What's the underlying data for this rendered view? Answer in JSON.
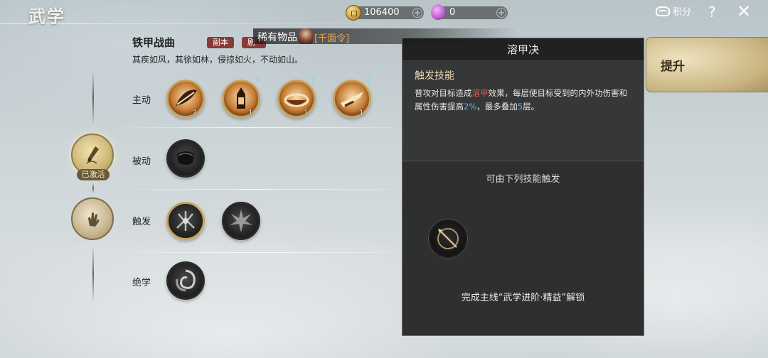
{
  "header": {
    "title": "武学",
    "coins": "106400",
    "gems": "0",
    "points_label": "积分",
    "help_label": "?",
    "close_label": "✕"
  },
  "set": {
    "name": "铁甲战曲",
    "tags": [
      "副本",
      "剧情"
    ],
    "motto": "其疾如风，其徐如林，侵掠如火，不动如山。"
  },
  "categories": {
    "active_label": "主动",
    "passive_label": "被动",
    "trigger_label": "触发",
    "ultimate_label": "绝学",
    "activated_label": "已激活"
  },
  "active_skills": [
    {
      "icon": "leaf-slash-icon",
      "level": "2",
      "upgradable": false
    },
    {
      "icon": "tower-strike-icon",
      "level": "1",
      "upgradable": true
    },
    {
      "icon": "ring-sweep-icon",
      "level": "1",
      "upgradable": true
    },
    {
      "icon": "blade-thrust-icon",
      "level": "1",
      "upgradable": true
    }
  ],
  "rare_bar": {
    "label": "稀有物品",
    "item": "[千面令]"
  },
  "detail": {
    "title": "溶甲决",
    "heading": "触发技能",
    "desc_pre": "普攻对目标造成",
    "desc_effect": "溶甲",
    "desc_mid": "效果，每层使目标受到的内外功伤害和属性伤害提高",
    "desc_pct": "2%",
    "desc_mid2": "，最多叠加",
    "desc_stack": "5",
    "desc_end": "层。",
    "trigger_heading": "可由下列技能触发",
    "unlock_text": "完成主线“武学进阶·精益”解锁"
  },
  "upgrade": {
    "label": "提升"
  },
  "colors": {
    "effect_red": "#e05a4a",
    "value_blue": "#5fb6e3",
    "rare_orange": "#f2a24a"
  }
}
